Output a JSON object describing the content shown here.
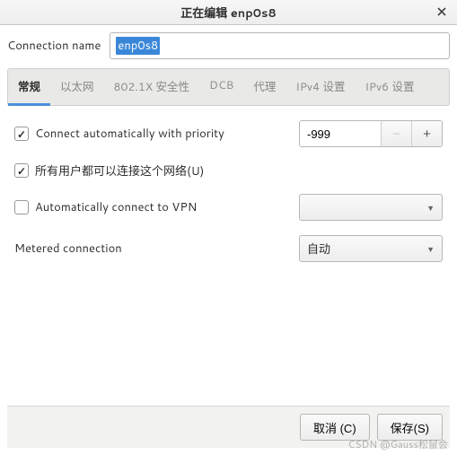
{
  "window": {
    "title": "正在编辑 enp0s8"
  },
  "name_row": {
    "label": "Connection name",
    "value": "enp0s8"
  },
  "tabs": [
    {
      "label": "常规"
    },
    {
      "label": "以太网"
    },
    {
      "label": "802.1X 安全性"
    },
    {
      "label": "DCB"
    },
    {
      "label": "代理"
    },
    {
      "label": "IPv4 设置"
    },
    {
      "label": "IPv6 设置"
    }
  ],
  "general": {
    "auto_connect_label": "Connect automatically with priority",
    "auto_connect_checked": true,
    "priority_value": "-999",
    "all_users_label": "所有用户都可以连接这个网络(U)",
    "all_users_checked": true,
    "auto_vpn_label": "Automatically connect to VPN",
    "auto_vpn_checked": false,
    "vpn_combo_value": "",
    "metered_label": "Metered connection",
    "metered_value": "自动"
  },
  "footer": {
    "cancel": "取消 (C)",
    "save": "保存(S)"
  },
  "watermark": "CSDN @Gauss松鼠会"
}
